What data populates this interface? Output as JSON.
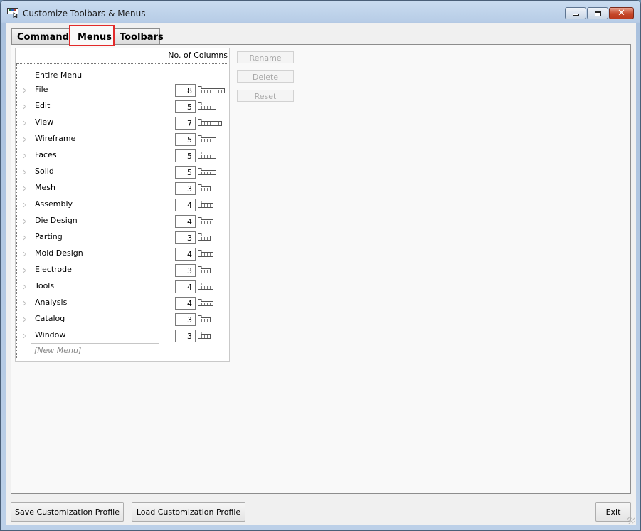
{
  "window": {
    "title": "Customize Toolbars & Menus"
  },
  "tabs": [
    {
      "label": "Commands",
      "active": false
    },
    {
      "label": "Menus",
      "active": true
    },
    {
      "label": "Toolbars",
      "active": false
    }
  ],
  "menu_list": {
    "column_header": "No. of Columns",
    "entire_menu_label": "Entire Menu",
    "items": [
      {
        "label": "File",
        "columns": "8"
      },
      {
        "label": "Edit",
        "columns": "5"
      },
      {
        "label": "View",
        "columns": "7"
      },
      {
        "label": "Wireframe",
        "columns": "5"
      },
      {
        "label": "Faces",
        "columns": "5"
      },
      {
        "label": "Solid",
        "columns": "5"
      },
      {
        "label": "Mesh",
        "columns": "3"
      },
      {
        "label": "Assembly",
        "columns": "4"
      },
      {
        "label": "Die Design",
        "columns": "4"
      },
      {
        "label": "Parting",
        "columns": "3"
      },
      {
        "label": "Mold Design",
        "columns": "4"
      },
      {
        "label": "Electrode",
        "columns": "3"
      },
      {
        "label": "Tools",
        "columns": "4"
      },
      {
        "label": "Analysis",
        "columns": "4"
      },
      {
        "label": "Catalog",
        "columns": "3"
      },
      {
        "label": "Window",
        "columns": "3"
      }
    ],
    "new_menu_placeholder": "[New Menu]"
  },
  "side_buttons": {
    "rename": "Rename",
    "delete": "Delete",
    "reset": "Reset"
  },
  "bottom_buttons": {
    "save": "Save Customization Profile",
    "load": "Load Customization Profile",
    "exit": "Exit"
  },
  "colors": {
    "tab_highlight": "#e22a2a",
    "close_button": "#c6482b",
    "disabled_text": "#a8a8a8"
  }
}
